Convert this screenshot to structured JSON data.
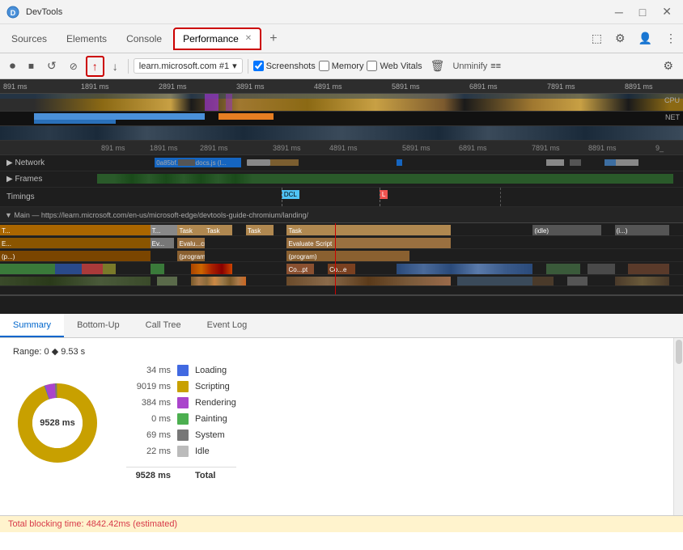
{
  "titleBar": {
    "appName": "DevTools",
    "minimize": "─",
    "maximize": "□",
    "close": "✕"
  },
  "tabs": {
    "items": [
      {
        "label": "Sources",
        "active": false
      },
      {
        "label": "Elements",
        "active": false
      },
      {
        "label": "Console",
        "active": false
      },
      {
        "label": "Performance",
        "active": true
      },
      {
        "label": "+",
        "active": false
      }
    ],
    "settingsLabel": "⚙",
    "moreLabel": "⋮",
    "shareLabel": "👤"
  },
  "toolbar": {
    "recordLabel": "⏺",
    "stopLabel": "⏹",
    "reloadLabel": "↺",
    "clearLabel": "🚫",
    "uploadLabel": "↑",
    "downloadLabel": "↓",
    "urlSelector": "learn.microsoft.com #1",
    "screenshots": "Screenshots",
    "memory": "Memory",
    "webVitals": "Web Vitals",
    "deleteLabel": "🗑",
    "unminifyLabel": "Unminify",
    "settingsLabel": "⚙"
  },
  "timeline": {
    "ruler": {
      "marks": [
        "891 ms",
        "1891 ms",
        "2891 ms",
        "3891 ms",
        "4891 ms",
        "5891 ms",
        "6891 ms",
        "7891 ms",
        "8891 ms"
      ]
    },
    "cpuLabel": "CPU",
    "netLabel": "NET",
    "tracks": {
      "ruler2": [
        "891 ms",
        "1891 ms",
        "2891 ms",
        "3891 ms",
        "4891 ms",
        "5891 ms",
        "6891 ms",
        "7891 ms",
        "8891 ms",
        "9_"
      ],
      "networkLabel": "▶ Network",
      "networkFile": "0a85bf.index-docs.js (l...",
      "framesLabel": "▶ Frames",
      "timingsLabel": "Timings",
      "dclLabel": "DCL",
      "lLabel": "L",
      "mainLabel": "▼ Main — https://learn.microsoft.com/en-us/microsoft-edge/devtools-guide-chromium/landing/",
      "tasks": [
        {
          "label": "T...",
          "color": "#888",
          "left": "22%",
          "width": "4%"
        },
        {
          "label": "Task",
          "color": "#b08050",
          "left": "27%",
          "width": "5%"
        },
        {
          "label": "Task",
          "color": "#b08050",
          "left": "33%",
          "width": "6%"
        },
        {
          "label": "Task",
          "color": "#b08050",
          "left": "40%",
          "width": "5%"
        },
        {
          "label": "Task",
          "color": "#b08050",
          "left": "50%",
          "width": "18%"
        },
        {
          "label": "(idle)",
          "color": "#666",
          "left": "80%",
          "width": "9%"
        },
        {
          "label": "(i...)",
          "color": "#666",
          "left": "90%",
          "width": "8%"
        }
      ]
    }
  },
  "bottomPanel": {
    "tabs": [
      "Summary",
      "Bottom-Up",
      "Call Tree",
      "Event Log"
    ],
    "activeTab": "Summary",
    "range": "Range: 0 ◆ 9.53 s",
    "items": [
      {
        "value": "34 ms",
        "color": "#4169e1",
        "label": "Loading"
      },
      {
        "value": "9019 ms",
        "color": "#c8a000",
        "label": "Scripting"
      },
      {
        "value": "384 ms",
        "color": "#aa44cc",
        "label": "Rendering"
      },
      {
        "value": "0 ms",
        "color": "#4caf50",
        "label": "Painting"
      },
      {
        "value": "69 ms",
        "color": "#777",
        "label": "System"
      },
      {
        "value": "22 ms",
        "color": "#bbb",
        "label": "Idle"
      }
    ],
    "total": {
      "value": "9528 ms",
      "label": "Total"
    },
    "totalMs": 9528,
    "donutLabel": "9528 ms"
  },
  "statusBar": {
    "text": "Total blocking time: 4842.42ms (estimated)"
  }
}
